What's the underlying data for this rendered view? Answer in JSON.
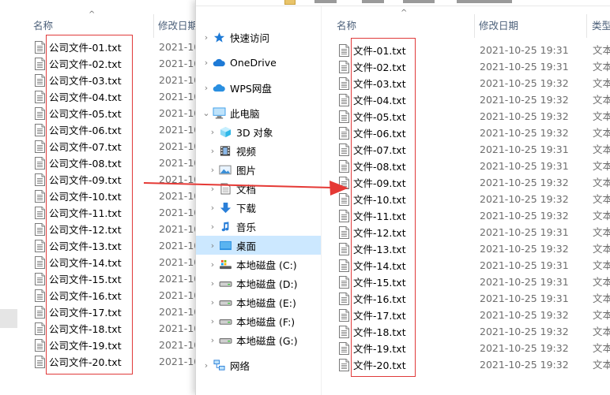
{
  "back_window": {
    "columns": {
      "name": "名称",
      "modified": "修改日期"
    },
    "files": [
      {
        "name": "公司文件-01.txt",
        "date": "2021-10"
      },
      {
        "name": "公司文件-02.txt",
        "date": "2021-10"
      },
      {
        "name": "公司文件-03.txt",
        "date": "2021-10"
      },
      {
        "name": "公司文件-04.txt",
        "date": "2021-10"
      },
      {
        "name": "公司文件-05.txt",
        "date": "2021-10"
      },
      {
        "name": "公司文件-06.txt",
        "date": "2021-10"
      },
      {
        "name": "公司文件-07.txt",
        "date": "2021-10"
      },
      {
        "name": "公司文件-08.txt",
        "date": "2021-10"
      },
      {
        "name": "公司文件-09.txt",
        "date": "2021-10"
      },
      {
        "name": "公司文件-10.txt",
        "date": "2021-10"
      },
      {
        "name": "公司文件-11.txt",
        "date": "2021-10"
      },
      {
        "name": "公司文件-12.txt",
        "date": "2021-10"
      },
      {
        "name": "公司文件-13.txt",
        "date": "2021-10"
      },
      {
        "name": "公司文件-14.txt",
        "date": "2021-10"
      },
      {
        "name": "公司文件-15.txt",
        "date": "2021-10"
      },
      {
        "name": "公司文件-16.txt",
        "date": "2021-10"
      },
      {
        "name": "公司文件-17.txt",
        "date": "2021-10"
      },
      {
        "name": "公司文件-18.txt",
        "date": "2021-10"
      },
      {
        "name": "公司文件-19.txt",
        "date": "2021-10"
      },
      {
        "name": "公司文件-20.txt",
        "date": "2021-10"
      }
    ]
  },
  "front_window": {
    "columns": {
      "name": "名称",
      "modified": "修改日期",
      "type": "类型"
    },
    "nav": [
      {
        "label": "快速访问",
        "icon": "star-icon",
        "color": "#1e7ad6"
      },
      {
        "label": "OneDrive",
        "icon": "cloud-icon",
        "color": "#1e7ad6"
      },
      {
        "label": "WPS网盘",
        "icon": "cloud-icon",
        "color": "#2a8fe0"
      },
      {
        "label": "此电脑",
        "icon": "computer-icon",
        "color": "#3b9de8"
      },
      {
        "label": "3D 对象",
        "icon": "cube-icon",
        "color": "#30b8e8"
      },
      {
        "label": "视频",
        "icon": "video-icon",
        "color": "#444444"
      },
      {
        "label": "图片",
        "icon": "picture-icon",
        "color": "#3b8fd6"
      },
      {
        "label": "文档",
        "icon": "document-icon",
        "color": "#6a6a6a"
      },
      {
        "label": "下载",
        "icon": "download-arrow-icon",
        "color": "#2a7fd8"
      },
      {
        "label": "音乐",
        "icon": "music-note-icon",
        "color": "#2a7fd8"
      },
      {
        "label": "桌面",
        "icon": "desktop-icon",
        "color": "#2a8fe0"
      },
      {
        "label": "本地磁盘 (C:)",
        "icon": "system-drive-icon",
        "color": "#5a5a5a"
      },
      {
        "label": "本地磁盘 (D:)",
        "icon": "drive-icon",
        "color": "#5a5a5a"
      },
      {
        "label": "本地磁盘 (E:)",
        "icon": "drive-icon",
        "color": "#5a5a5a"
      },
      {
        "label": "本地磁盘 (F:)",
        "icon": "drive-icon",
        "color": "#5a5a5a"
      },
      {
        "label": "本地磁盘 (G:)",
        "icon": "drive-icon",
        "color": "#5a5a5a"
      },
      {
        "label": "网络",
        "icon": "network-icon",
        "color": "#2a7fd8"
      }
    ],
    "selected_nav": "桌面",
    "files": [
      {
        "name": "文件-01.txt",
        "date": "2021-10-25 19:31",
        "type": "文本"
      },
      {
        "name": "文件-02.txt",
        "date": "2021-10-25 19:31",
        "type": "文本"
      },
      {
        "name": "文件-03.txt",
        "date": "2021-10-25 19:32",
        "type": "文本"
      },
      {
        "name": "文件-04.txt",
        "date": "2021-10-25 19:32",
        "type": "文本"
      },
      {
        "name": "文件-05.txt",
        "date": "2021-10-25 19:32",
        "type": "文本"
      },
      {
        "name": "文件-06.txt",
        "date": "2021-10-25 19:32",
        "type": "文本"
      },
      {
        "name": "文件-07.txt",
        "date": "2021-10-25 19:31",
        "type": "文本"
      },
      {
        "name": "文件-08.txt",
        "date": "2021-10-25 19:31",
        "type": "文本"
      },
      {
        "name": "文件-09.txt",
        "date": "2021-10-25 19:32",
        "type": "文本"
      },
      {
        "name": "文件-10.txt",
        "date": "2021-10-25 19:32",
        "type": "文本"
      },
      {
        "name": "文件-11.txt",
        "date": "2021-10-25 19:32",
        "type": "文本"
      },
      {
        "name": "文件-12.txt",
        "date": "2021-10-25 19:31",
        "type": "文本"
      },
      {
        "name": "文件-13.txt",
        "date": "2021-10-25 19:32",
        "type": "文本"
      },
      {
        "name": "文件-14.txt",
        "date": "2021-10-25 19:31",
        "type": "文本"
      },
      {
        "name": "文件-15.txt",
        "date": "2021-10-25 19:31",
        "type": "文本"
      },
      {
        "name": "文件-16.txt",
        "date": "2021-10-25 19:31",
        "type": "文本"
      },
      {
        "name": "文件-17.txt",
        "date": "2021-10-25 19:32",
        "type": "文本"
      },
      {
        "name": "文件-18.txt",
        "date": "2021-10-25 19:32",
        "type": "文本"
      },
      {
        "name": "文件-19.txt",
        "date": "2021-10-25 19:32",
        "type": "文本"
      },
      {
        "name": "文件-20.txt",
        "date": "2021-10-25 19:32",
        "type": "文本"
      }
    ]
  },
  "annotation": {
    "highlight_color": "#e03a3a",
    "arrow_color": "#e53935"
  }
}
